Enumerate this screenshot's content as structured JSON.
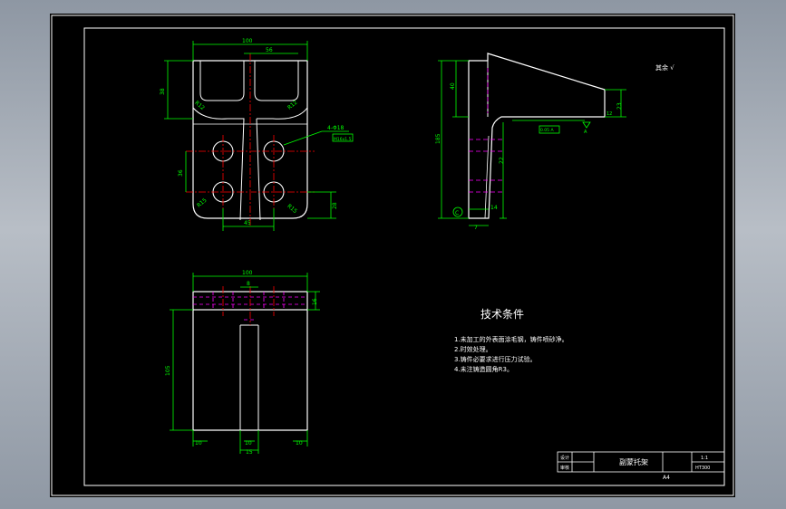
{
  "colors": {
    "background": "#000000",
    "outline": "#ffffff",
    "dimension": "#00ff00",
    "centerline": "#ff0000",
    "hidden_line": "#ff00ff",
    "text": "#ffffff",
    "app_chrome": "#a6adb6"
  },
  "front_view": {
    "dim_width": "100",
    "dim_top_inner": "56",
    "dim_height_left": "38",
    "dim_hole_spacing": "36",
    "dim_bottom": "45",
    "dim_right_low": "28",
    "hole_callout": "4-Φ18",
    "hole_note": "M16x1.5",
    "fillet_tl": "R12",
    "fillet_tr": "R12",
    "fillet_bl": "R15",
    "fillet_br": "R15"
  },
  "side_view": {
    "dim_top": "40",
    "dim_height": "185",
    "dim_mid": "22",
    "dim_right": "23",
    "dim_bottom_a": "14",
    "dim_bottom_b": "7",
    "dim_right_inner": "12",
    "surface_note": "0.05 A",
    "datum": "A",
    "section_mark": "C"
  },
  "bottom_view": {
    "dim_width": "100",
    "dim_center": "8",
    "dim_side": "16",
    "dim_height": "105",
    "dim_foot_l": "10",
    "dim_foot_m": "10",
    "dim_foot_r": "10",
    "dim_rib": "15"
  },
  "roughness_note": "其余 √",
  "tech_requirements": {
    "title": "技术条件",
    "items": [
      "1.未加工的外表面涂毛钢，铸件喷砂净。",
      "2.时效处理。",
      "3.铸件必要求进行压力试验。",
      "4.未注铸造圆角R3。"
    ]
  },
  "title_block": {
    "designer_label": "设计",
    "checker_label": "审核",
    "part_name": "副蒙托架",
    "scale": "1:1",
    "drawing_no": "HT300",
    "sheet_size": "A4"
  }
}
